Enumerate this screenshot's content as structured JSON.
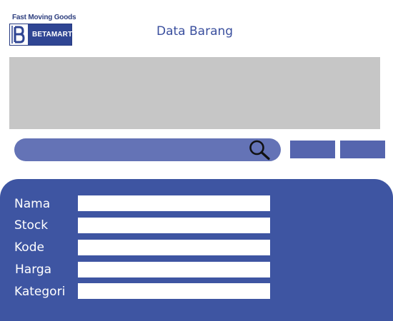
{
  "logo": {
    "tagline": "Fast Moving Goods",
    "name": "BETAMART",
    "mark_icon": "letter-b-logo-icon"
  },
  "header": {
    "title": "Data Barang"
  },
  "search": {
    "value": "",
    "placeholder": "",
    "icon": "magnifier-icon"
  },
  "actions": {
    "button_1_label": "",
    "button_2_label": ""
  },
  "form": {
    "fields": [
      {
        "label": "Nama",
        "value": ""
      },
      {
        "label": "Stock",
        "value": ""
      },
      {
        "label": "Kode",
        "value": ""
      },
      {
        "label": "Harga",
        "value": ""
      },
      {
        "label": "Kategori",
        "value": ""
      }
    ]
  },
  "colors": {
    "brand_dark": "#2f4593",
    "title_text": "#3a4f9e",
    "banner_gray": "#c6c6c6",
    "search_bar": "#6473b6",
    "action_button": "#5565ae",
    "form_panel": "#3e55a2"
  }
}
